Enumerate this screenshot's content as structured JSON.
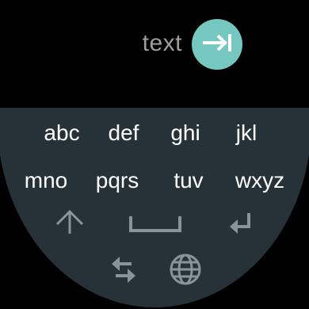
{
  "input": {
    "text": "text"
  },
  "send": {
    "icon": "send-tab-icon",
    "color": "#74c8bf"
  },
  "keyboard": {
    "background": "#263238",
    "rows": [
      [
        "abc",
        "def",
        "ghi",
        "jkl"
      ],
      [
        "mno",
        "pqrs",
        "tuv",
        "wxyz"
      ]
    ],
    "function_keys": {
      "shift": "shift-arrow-icon",
      "space": "space-bar-icon",
      "enter": "enter-return-icon",
      "switch": "swap-arrows-icon",
      "language": "globe-icon"
    },
    "key_text_color": "#ffffff",
    "icon_color": "#8a9398"
  }
}
